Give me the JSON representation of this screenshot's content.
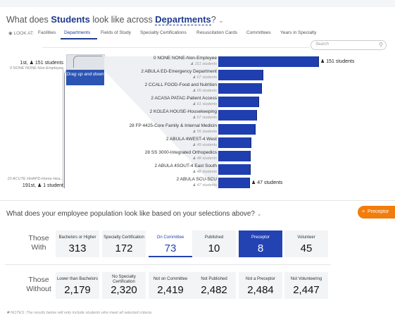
{
  "header": {
    "q_prefix": "What does",
    "q_subject": "Students",
    "q_mid": "look like across",
    "q_dimension": "Departments",
    "q_suffix": "?",
    "look_at_label": "LOOK AT:",
    "tabs": [
      "Facilities",
      "Departments",
      "Fields of Study",
      "Specialty Certifications",
      "Resuscitation Cards",
      "Committees",
      "Years in Specialty"
    ],
    "active_tab": "Departments",
    "search_placeholder": "Search"
  },
  "overview": {
    "drag_label": "Drag up and down",
    "first_rank": "1st,",
    "first_count": "151 students",
    "first_name": "0 NONE NONE-Non-Employee",
    "last_name": "10 ACUTE HHAPD-Home Hea...",
    "last_rank": "191st,",
    "last_count": "1 student"
  },
  "departments": [
    {
      "name": "0 NONE NONE-Non-Employee",
      "count": 151,
      "sub": "151 students",
      "end_label": "151 students"
    },
    {
      "name": "2 ABULA ED-Emergency Department",
      "count": 67,
      "sub": "67 students"
    },
    {
      "name": "2 CCALL FOOD-Food and Nutrition",
      "count": 65,
      "sub": "65 students"
    },
    {
      "name": "2 ACASA PATAC-Patient Access",
      "count": 61,
      "sub": "61 students"
    },
    {
      "name": "2 KOLEA HOUSE-Housekeeping",
      "count": 57,
      "sub": "57 students"
    },
    {
      "name": "28 FP 4425-Core Family & Internal Medicin",
      "count": 55,
      "sub": "55 students"
    },
    {
      "name": "2 ABULA 4WEST-4 West",
      "count": 49,
      "sub": "49 students"
    },
    {
      "name": "28 SS 3000-Integrated Orthopedics",
      "count": 48,
      "sub": "48 students"
    },
    {
      "name": "2 ABULA 4SOUT-4 East South",
      "count": 48,
      "sub": "48 students"
    },
    {
      "name": "2 ABULA SCU-SCU",
      "count": 47,
      "sub": "47 students",
      "end_label": "47 students"
    }
  ],
  "population": {
    "question": "What does your employee population look like based on your selections above?",
    "preceptor_chip": "Preceptor",
    "with_label": [
      "Those",
      "With"
    ],
    "without_label": [
      "Those",
      "Without"
    ],
    "with": [
      {
        "title": "Bachelors or Higher",
        "value": "313"
      },
      {
        "title": "Specialty Certification",
        "value": "172"
      },
      {
        "title": "On Committee",
        "value": "73"
      },
      {
        "title": "Published",
        "value": "10"
      },
      {
        "title": "Preceptor",
        "value": "8"
      },
      {
        "title": "Volunteer",
        "value": "45"
      }
    ],
    "without": [
      {
        "title": "Lower than Bachelors",
        "value": "2,179"
      },
      {
        "title": "No Specialty Certification",
        "value": "2,320"
      },
      {
        "title": "Not on Committee",
        "value": "2,419"
      },
      {
        "title": "Not Published",
        "value": "2,482"
      },
      {
        "title": "Not a Preceptor",
        "value": "2,484"
      },
      {
        "title": "Not Volunteering",
        "value": "2,447"
      }
    ],
    "note": "NOTES: The results below will only include students who meet all selected criteria."
  },
  "colors": {
    "accent": "#1f3fb0",
    "chip": "#f27d0c"
  },
  "icons": [
    "eye-icon",
    "search-icon",
    "person-icon",
    "chevron-down-icon",
    "close-icon",
    "asterisk-icon"
  ]
}
